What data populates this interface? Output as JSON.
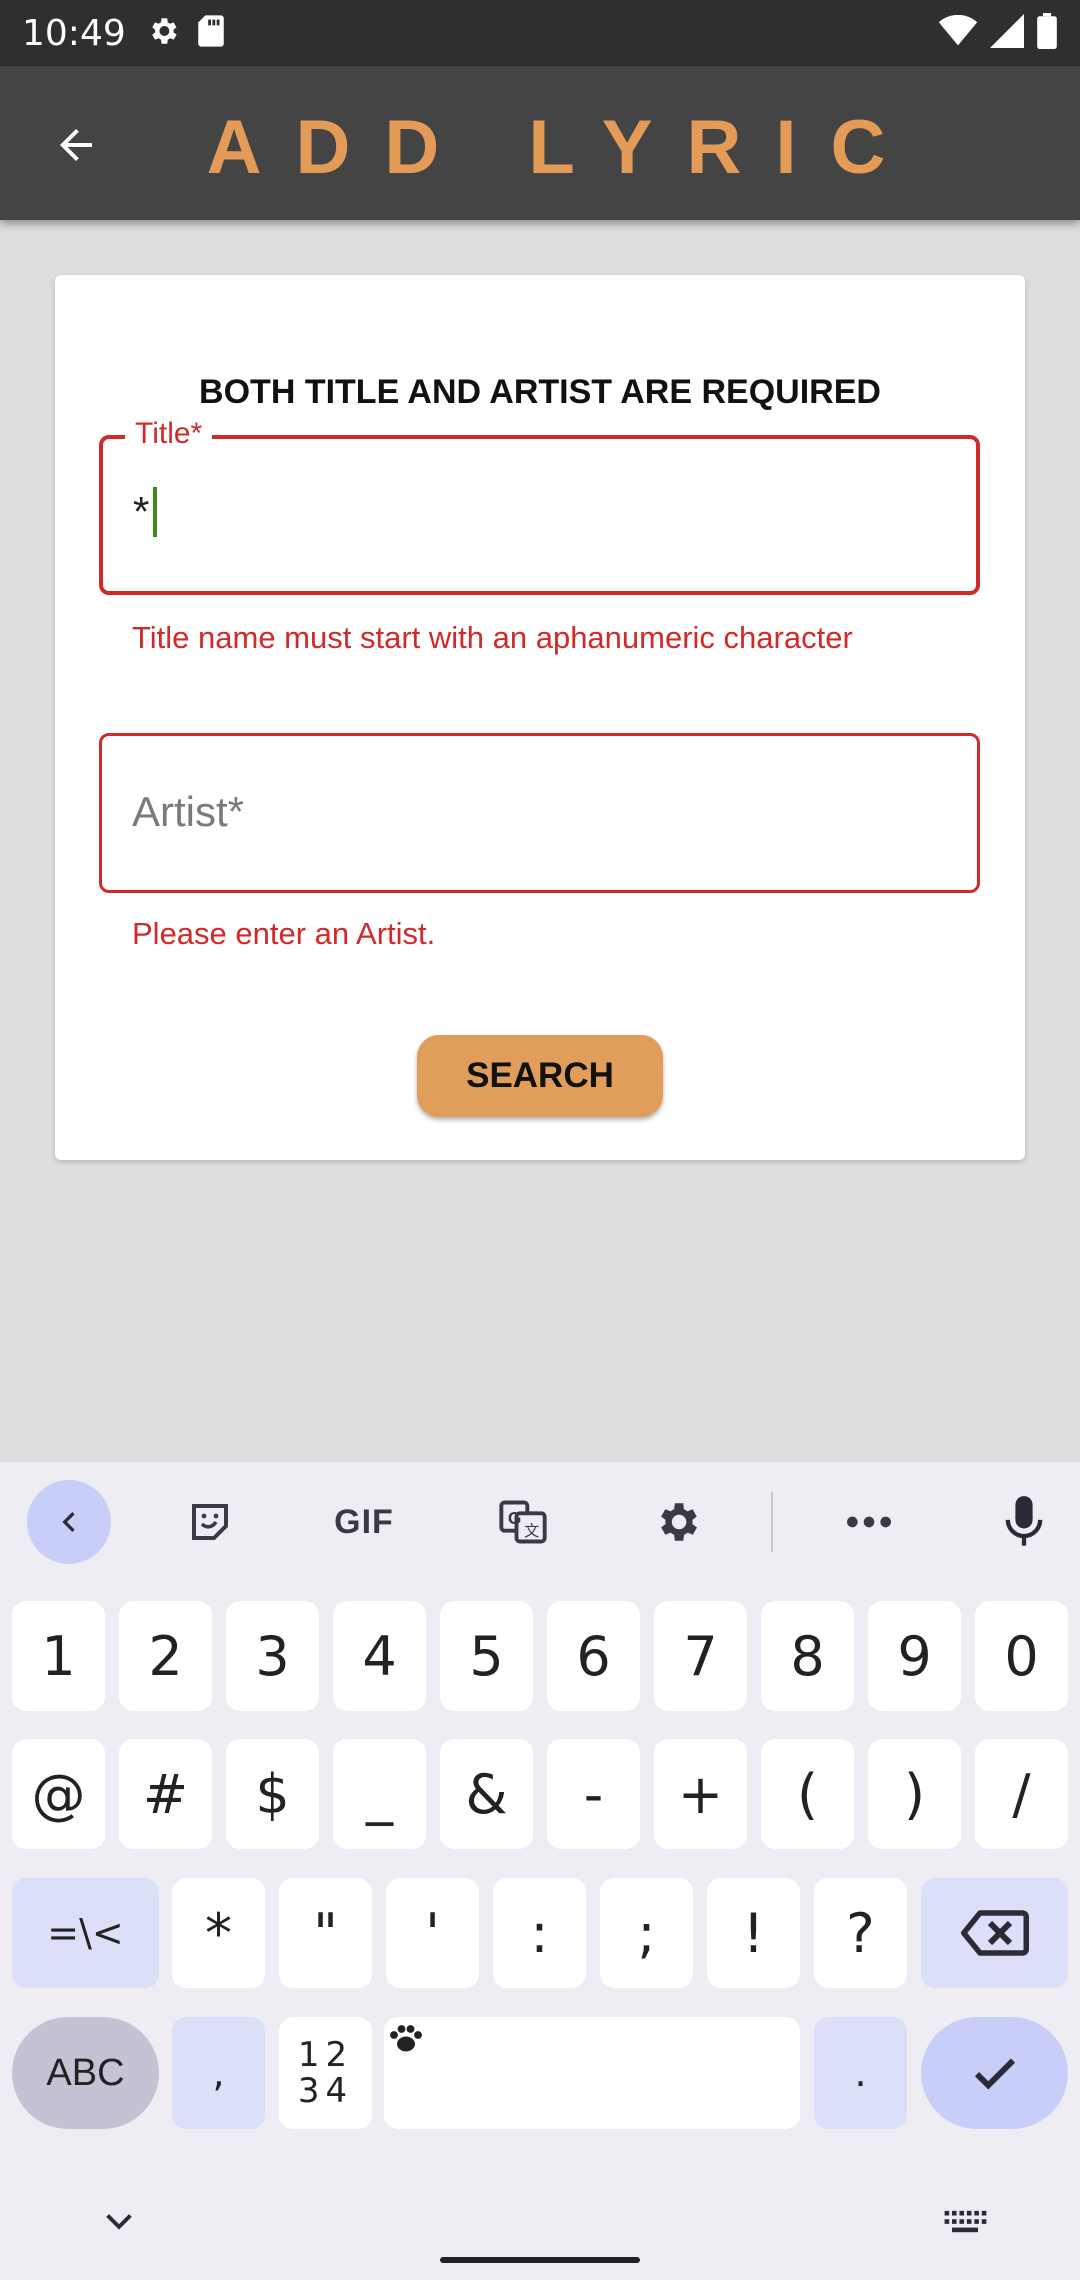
{
  "status_bar": {
    "time": "10:49",
    "left_icons": [
      "settings-icon",
      "sd-card-icon"
    ],
    "right_icons": [
      "wifi-icon",
      "signal-icon",
      "battery-icon"
    ]
  },
  "app_bar": {
    "title": "ADD LYRIC",
    "back_icon": "arrow-left-icon",
    "title_color": "#e49b57"
  },
  "form": {
    "heading": "BOTH TITLE AND ARTIST ARE REQUIRED",
    "title_field": {
      "label": "Title*",
      "value": "*",
      "error": "Title name must start with an aphanumeric character"
    },
    "artist_field": {
      "placeholder": "Artist*",
      "value": "",
      "error": "Please enter an Artist."
    },
    "search_label": "SEARCH",
    "error_color": "#d22a2a",
    "button_color": "#e09e5a"
  },
  "keyboard": {
    "toolbar": {
      "gif_label": "GIF",
      "icons": [
        "chevron-left-icon",
        "sticker-icon",
        "gif-icon",
        "translate-icon",
        "gear-icon",
        "more-icon",
        "microphone-icon"
      ]
    },
    "row1": [
      "1",
      "2",
      "3",
      "4",
      "5",
      "6",
      "7",
      "8",
      "9",
      "0"
    ],
    "row2": [
      "@",
      "#",
      "$",
      "_",
      "&",
      "-",
      "+",
      "(",
      ")",
      "/"
    ],
    "row3": {
      "shift_label": "=\\<",
      "keys": [
        "*",
        "\"",
        "'",
        ":",
        ";",
        "!",
        "?"
      ]
    },
    "row4": {
      "abc_label": "ABC",
      "comma": ",",
      "numpad_top": "12",
      "numpad_bottom": "34",
      "period": "."
    }
  }
}
